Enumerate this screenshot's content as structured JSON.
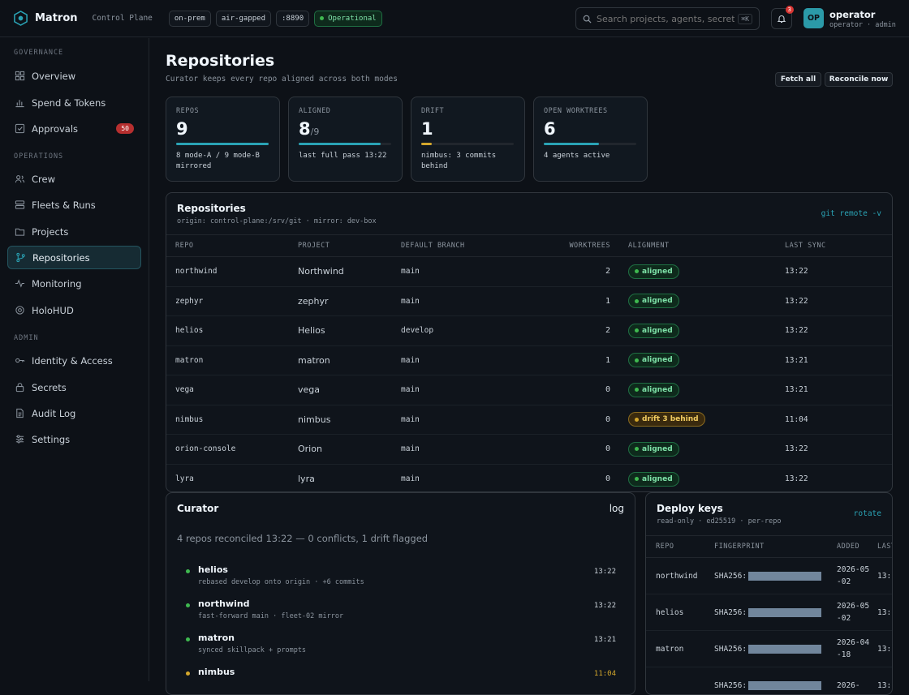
{
  "header": {
    "brand": "Matron",
    "subtitle": "Control Plane",
    "chips": [
      "on-prem",
      "air-gapped",
      ":8890"
    ],
    "status": "Operational",
    "search_placeholder": "Search projects, agents, secrets...",
    "search_shortcut": "⌘K",
    "notifications": "3",
    "avatar_initials": "OP",
    "user_name": "operator",
    "user_role": "operator · admin"
  },
  "sidebar": {
    "sections": [
      "GOVERNANCE",
      "OPERATIONS",
      "ADMIN"
    ],
    "items": [
      {
        "label": "Overview",
        "icon": "grid-icon"
      },
      {
        "label": "Spend & Tokens",
        "icon": "bar-chart-icon"
      },
      {
        "label": "Approvals",
        "icon": "check-square-icon",
        "badge": "50"
      },
      {
        "label": "Crew",
        "icon": "users-icon"
      },
      {
        "label": "Fleets & Runs",
        "icon": "server-icon"
      },
      {
        "label": "Projects",
        "icon": "folder-icon"
      },
      {
        "label": "Repositories",
        "icon": "git-branch-icon",
        "active": true
      },
      {
        "label": "Monitoring",
        "icon": "pulse-icon"
      },
      {
        "label": "HoloHUD",
        "icon": "target-icon"
      },
      {
        "label": "Identity & Access",
        "icon": "key-icon"
      },
      {
        "label": "Secrets",
        "icon": "lock-icon"
      },
      {
        "label": "Audit Log",
        "icon": "document-icon"
      },
      {
        "label": "Settings",
        "icon": "sliders-icon"
      }
    ]
  },
  "page": {
    "title": "Repositories",
    "subtitle": "Curator keeps every repo aligned across both modes",
    "fetch_all": "Fetch all",
    "reconcile_now": "Reconcile now"
  },
  "stats": [
    {
      "label": "REPOS",
      "value": "9",
      "suffix": "",
      "fill": 1.0,
      "color": "#2aa3b5",
      "note": "8 mode-A / 9 mode-B mirrored"
    },
    {
      "label": "ALIGNED",
      "value": "8",
      "suffix": "/9",
      "fill": 0.89,
      "color": "#2aa3b5",
      "note": "last full pass 13:22"
    },
    {
      "label": "DRIFT",
      "value": "1",
      "suffix": "",
      "fill": 0.11,
      "color": "#d4a72c",
      "note": "nimbus: 3 commits behind"
    },
    {
      "label": "OPEN WORKTREES",
      "value": "6",
      "suffix": "",
      "fill": 0.6,
      "color": "#2aa3b5",
      "note": "4 agents active"
    }
  ],
  "repos_panel": {
    "title": "Repositories",
    "sub": "origin: control-plane:/srv/git · mirror: dev-box",
    "action": "git remote -v",
    "columns": [
      "REPO",
      "PROJECT",
      "DEFAULT BRANCH",
      "WORKTREES",
      "ALIGNMENT",
      "LAST SYNC"
    ],
    "rows": [
      {
        "repo": "northwind",
        "project": "Northwind",
        "branch": "main",
        "worktrees": "2",
        "alignment": "aligned",
        "status": "ok",
        "sync": "13:22"
      },
      {
        "repo": "zephyr",
        "project": "zephyr",
        "branch": "main",
        "worktrees": "1",
        "alignment": "aligned",
        "status": "ok",
        "sync": "13:22"
      },
      {
        "repo": "helios",
        "project": "Helios",
        "branch": "develop",
        "worktrees": "2",
        "alignment": "aligned",
        "status": "ok",
        "sync": "13:22"
      },
      {
        "repo": "matron",
        "project": "matron",
        "branch": "main",
        "worktrees": "1",
        "alignment": "aligned",
        "status": "ok",
        "sync": "13:21"
      },
      {
        "repo": "vega",
        "project": "vega",
        "branch": "main",
        "worktrees": "0",
        "alignment": "aligned",
        "status": "ok",
        "sync": "13:21"
      },
      {
        "repo": "nimbus",
        "project": "nimbus",
        "branch": "main",
        "worktrees": "0",
        "alignment": "drift 3 behind",
        "status": "warn",
        "sync": "11:04"
      },
      {
        "repo": "orion-console",
        "project": "Orion",
        "branch": "main",
        "worktrees": "0",
        "alignment": "aligned",
        "status": "ok",
        "sync": "13:22"
      },
      {
        "repo": "lyra",
        "project": "lyra",
        "branch": "main",
        "worktrees": "0",
        "alignment": "aligned",
        "status": "ok",
        "sync": "13:22"
      }
    ]
  },
  "curator": {
    "title": "Curator",
    "action": "log",
    "summary": "4 repos reconciled 13:22 — 0 conflicts, 1 drift flagged",
    "items": [
      {
        "title": "helios",
        "desc": "rebased develop onto origin · +6 commits",
        "time": "13:22",
        "status": "ok"
      },
      {
        "title": "northwind",
        "desc": "fast-forward main · fleet-02 mirror",
        "time": "13:22",
        "status": "ok"
      },
      {
        "title": "matron",
        "desc": "synced skillpack + prompts",
        "time": "13:21",
        "status": "ok"
      },
      {
        "title": "nimbus",
        "desc": "",
        "time": "11:04",
        "status": "warn"
      }
    ]
  },
  "deploy_keys": {
    "title": "Deploy keys",
    "sub": "read-only · ed25519 · per-repo",
    "action": "rotate",
    "columns": [
      "REPO",
      "FINGERPRINT",
      "ADDED",
      "LAST"
    ],
    "rows": [
      {
        "repo": "northwind",
        "fp": "SHA256:",
        "added": "2026-05-02",
        "last": "13:"
      },
      {
        "repo": "helios",
        "fp": "SHA256:",
        "added": "2026-05-02",
        "last": "13:"
      },
      {
        "repo": "matron",
        "fp": "SHA256:",
        "added": "2026-04-18",
        "last": "13:"
      },
      {
        "repo": "",
        "fp": "SHA256:",
        "added": "2026-",
        "last": "13:"
      }
    ]
  },
  "colors": {
    "accent": "#2aa3b5",
    "ok": "#3fb950",
    "warn": "#d4a72c",
    "danger": "#da3633"
  }
}
